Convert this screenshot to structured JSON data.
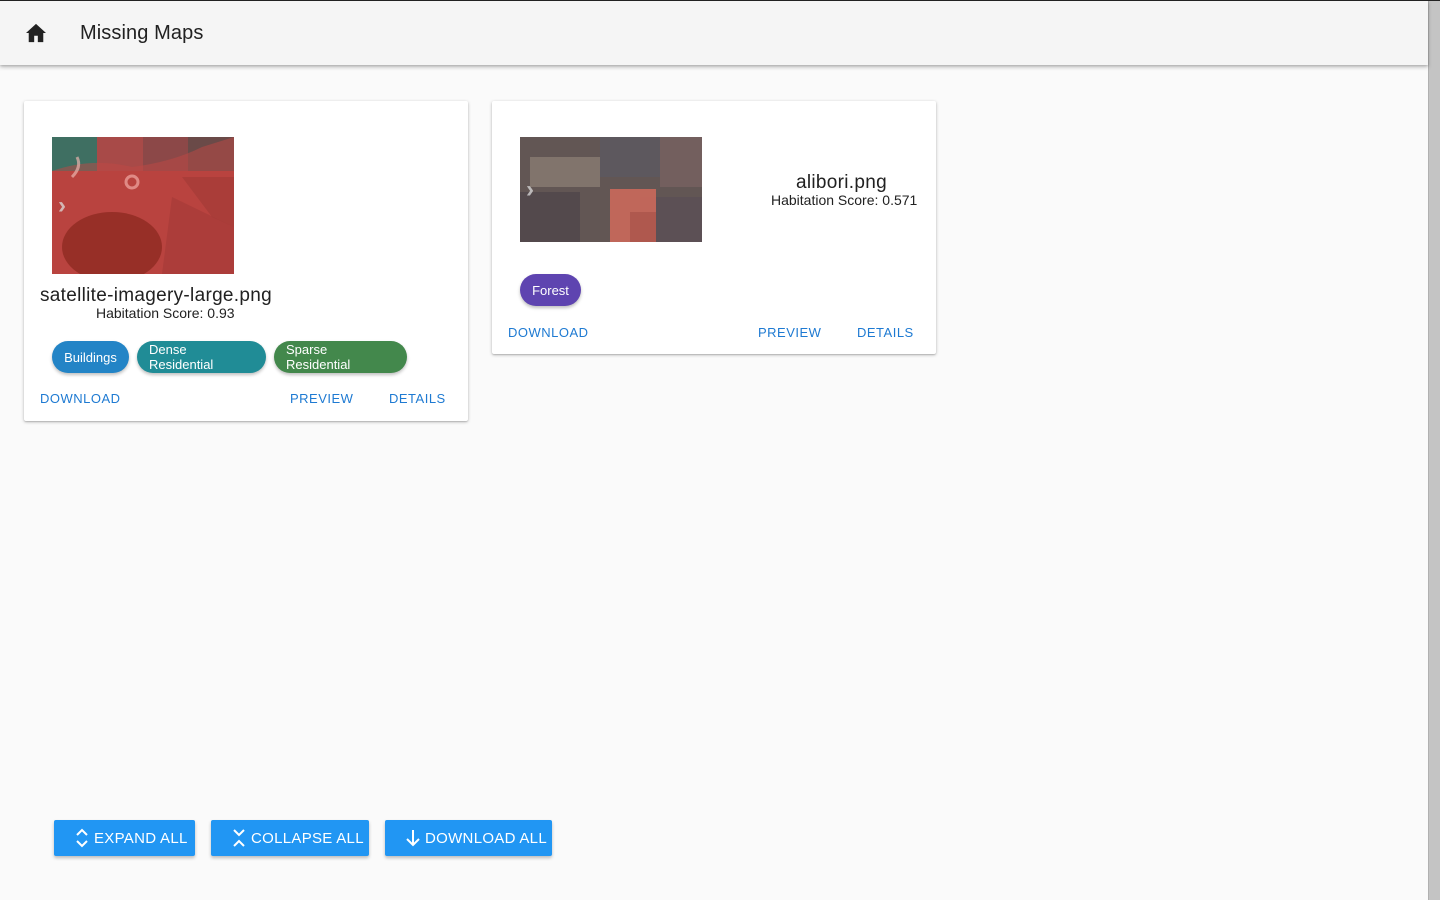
{
  "header": {
    "title": "Missing Maps",
    "home_icon": "home-icon"
  },
  "cards": [
    {
      "filename": "satellite-imagery-large.png",
      "score_label": "Habitation Score: 0.93",
      "score": 0.93,
      "thumbnail_nav_icon": "chevron-right-icon",
      "tags": [
        {
          "label": "Buildings",
          "color": "#2384c6"
        },
        {
          "label": "Dense Residential",
          "color": "#208c96"
        },
        {
          "label": "Sparse Residential",
          "color": "#43884c"
        }
      ],
      "actions": {
        "download": "Download",
        "preview": "Preview",
        "details": "Details"
      }
    },
    {
      "filename": "alibori.png",
      "score_label": "Habitation Score: 0.571",
      "score": 0.571,
      "thumbnail_nav_icon": "chevron-right-icon",
      "tags": [
        {
          "label": "Forest",
          "color": "#5e44b0"
        }
      ],
      "actions": {
        "download": "Download",
        "preview": "Preview",
        "details": "Details"
      }
    }
  ],
  "footer": {
    "expand_all": "EXPAND ALL",
    "collapse_all": "COLLAPSE ALL",
    "download_all": "DOWNLOAD ALL",
    "accent": "#2196f3"
  }
}
